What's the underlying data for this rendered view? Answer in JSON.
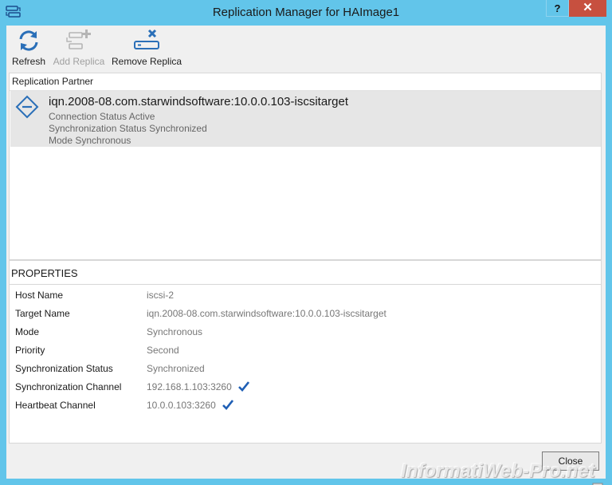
{
  "window": {
    "title": "Replication Manager for HAImage1",
    "help_label": "?",
    "close_label": "✕"
  },
  "toolbar": {
    "refresh_label": "Refresh",
    "add_label": "Add Replica",
    "remove_label": "Remove Replica"
  },
  "partner": {
    "header": "Replication Partner",
    "iqn": "iqn.2008-08.com.starwindsoftware:10.0.0.103-iscsitarget",
    "connection_status": "Connection Status Active",
    "sync_status": "Synchronization Status Synchronized",
    "mode": "Mode Synchronous"
  },
  "properties": {
    "header": "PROPERTIES",
    "rows": [
      {
        "label": "Host Name",
        "value": "iscsi-2"
      },
      {
        "label": "Target Name",
        "value": "iqn.2008-08.com.starwindsoftware:10.0.0.103-iscsitarget"
      },
      {
        "label": "Mode",
        "value": "Synchronous"
      },
      {
        "label": "Priority",
        "value": "Second"
      },
      {
        "label": "Synchronization Status",
        "value": "Synchronized"
      },
      {
        "label": "Synchronization Channel",
        "value": "192.168.1.103:3260"
      },
      {
        "label": "Heartbeat Channel",
        "value": "10.0.0.103:3260"
      }
    ]
  },
  "footer": {
    "close_label": "Close"
  },
  "watermark": {
    "text": "InformatiWeb-Pro.net"
  },
  "colors": {
    "title_bar": "#62c5ea",
    "close_button": "#c7503f",
    "icon_blue": "#2a6fb8",
    "check_blue": "#1f5fb5"
  }
}
